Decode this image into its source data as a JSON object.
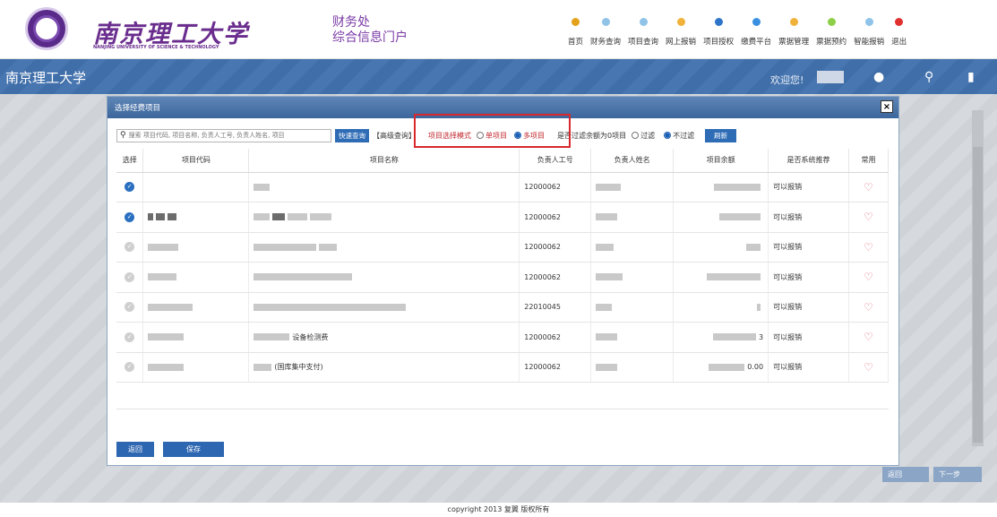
{
  "header": {
    "university_cn": "南京理工大学",
    "university_en": "NANJING UNIVERSITY OF SCIENCE & TECHNOLOGY",
    "portal_line1": "财务处",
    "portal_line2": "综合信息门户",
    "nav": [
      {
        "label": "首页",
        "color": "#e3a21a"
      },
      {
        "label": "财务查询",
        "color": "#8fc3e8"
      },
      {
        "label": "项目查询",
        "color": "#8fc3e8"
      },
      {
        "label": "网上报销",
        "color": "#f0b23a"
      },
      {
        "label": "项目授权",
        "color": "#2e74c9"
      },
      {
        "label": "缴费平台",
        "color": "#3a8fe0"
      },
      {
        "label": "票据管理",
        "color": "#f0b23a"
      },
      {
        "label": "票据预约",
        "color": "#8ecf4a"
      },
      {
        "label": "智能报销",
        "color": "#8fc3e8"
      },
      {
        "label": "退出",
        "color": "#e0312e"
      }
    ]
  },
  "band": {
    "title": "南京理工大学",
    "welcome": "欢迎您!"
  },
  "dialog": {
    "title": "选择经费项目",
    "close": "×",
    "search_placeholder": "搜索 项目代码, 项目名称, 负责人工号, 负责人姓名, 项目",
    "quick_query": "快速查询",
    "advanced_query": "【高级查询】",
    "mode_label": "项目选择模式",
    "single": "单项目",
    "multi": "多项目",
    "filter_label": "是否过滤余额为0项目",
    "filter_yes": "过滤",
    "filter_no": "不过滤",
    "refresh": "刷新",
    "columns": [
      "选择",
      "项目代码",
      "项目名称",
      "负责人工号",
      "负责人姓名",
      "项目余额",
      "是否系统推荐",
      "常用"
    ],
    "rows": [
      {
        "checked": true,
        "name_text": "",
        "staff_no": "12000062",
        "balance_tail": "",
        "recommend": "可以报销"
      },
      {
        "checked": true,
        "name_text": "",
        "staff_no": "12000062",
        "balance_tail": "",
        "recommend": "可以报销"
      },
      {
        "checked": false,
        "name_text": "",
        "staff_no": "12000062",
        "balance_tail": "",
        "recommend": "可以报销"
      },
      {
        "checked": false,
        "name_text": "",
        "staff_no": "12000062",
        "balance_tail": "",
        "recommend": "可以报销"
      },
      {
        "checked": false,
        "name_text": "",
        "staff_no": "22010045",
        "balance_tail": "",
        "recommend": "可以报销"
      },
      {
        "checked": false,
        "name_text": "设备检测费",
        "staff_no": "12000062",
        "balance_tail": "3",
        "recommend": "可以报销"
      },
      {
        "checked": false,
        "name_text": "(国库集中支付)",
        "staff_no": "12000062",
        "balance_tail": "0.00",
        "recommend": "可以报销"
      }
    ],
    "back": "返回",
    "save": "保存"
  },
  "page": {
    "back": "返回",
    "next": "下一步",
    "footer": "copyright 2013 复翼 版权所有"
  }
}
